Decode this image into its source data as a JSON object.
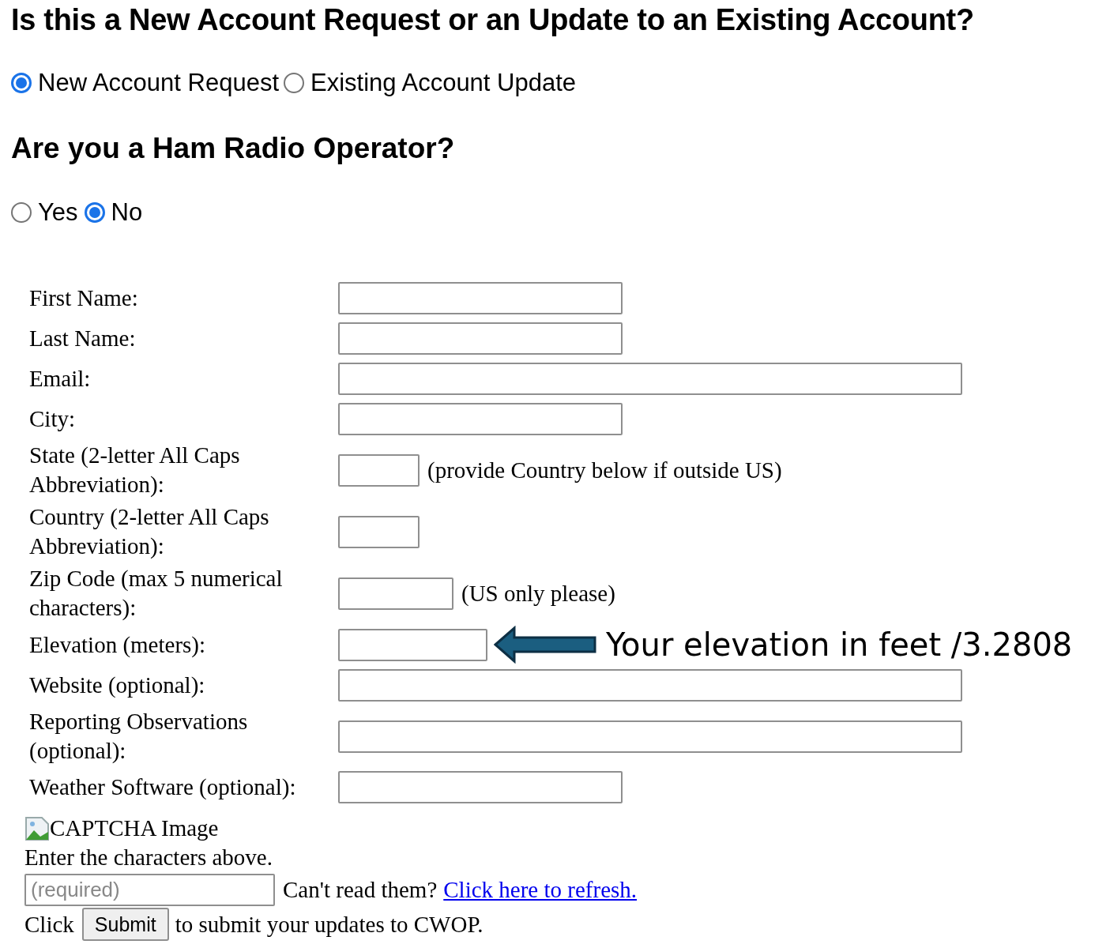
{
  "heading_account": "Is this a New Account Request or an Update to an Existing Account?",
  "account_options": [
    {
      "label": "New Account Request",
      "selected": true
    },
    {
      "label": "Existing Account Update",
      "selected": false
    }
  ],
  "heading_ham": "Are you a Ham Radio Operator?",
  "ham_options": [
    {
      "label": "Yes",
      "selected": false
    },
    {
      "label": "No",
      "selected": true
    }
  ],
  "fields": [
    {
      "label": "First Name:",
      "kind": "medium"
    },
    {
      "label": "Last Name:",
      "kind": "medium"
    },
    {
      "label": "Email:",
      "kind": "wide"
    },
    {
      "label": "City:",
      "kind": "medium"
    },
    {
      "label": "State (2-letter All Caps Abbreviation):",
      "kind": "tiny",
      "note": "(provide Country below if outside US)"
    },
    {
      "label": "Country (2-letter All Caps Abbreviation):",
      "kind": "tiny"
    },
    {
      "label": "Zip Code (max 5 numerical characters):",
      "kind": "small",
      "note": "(US only please)"
    },
    {
      "label": "Elevation (meters):",
      "kind": "elevation",
      "annotation": "Your elevation in feet /3.2808"
    },
    {
      "label": "Website (optional):",
      "kind": "wide"
    },
    {
      "label": "Reporting Observations (optional):",
      "kind": "wide"
    },
    {
      "label": "Weather Software (optional):",
      "kind": "medium"
    }
  ],
  "captcha": {
    "image_alt": "CAPTCHA Image",
    "instruction": "Enter the characters above.",
    "placeholder": "(required)",
    "prompt": "Can't read them?",
    "refresh_link": "Click here to refresh."
  },
  "submit_row": {
    "before": "Click",
    "button": "Submit",
    "after": "to submit your updates to CWOP."
  }
}
